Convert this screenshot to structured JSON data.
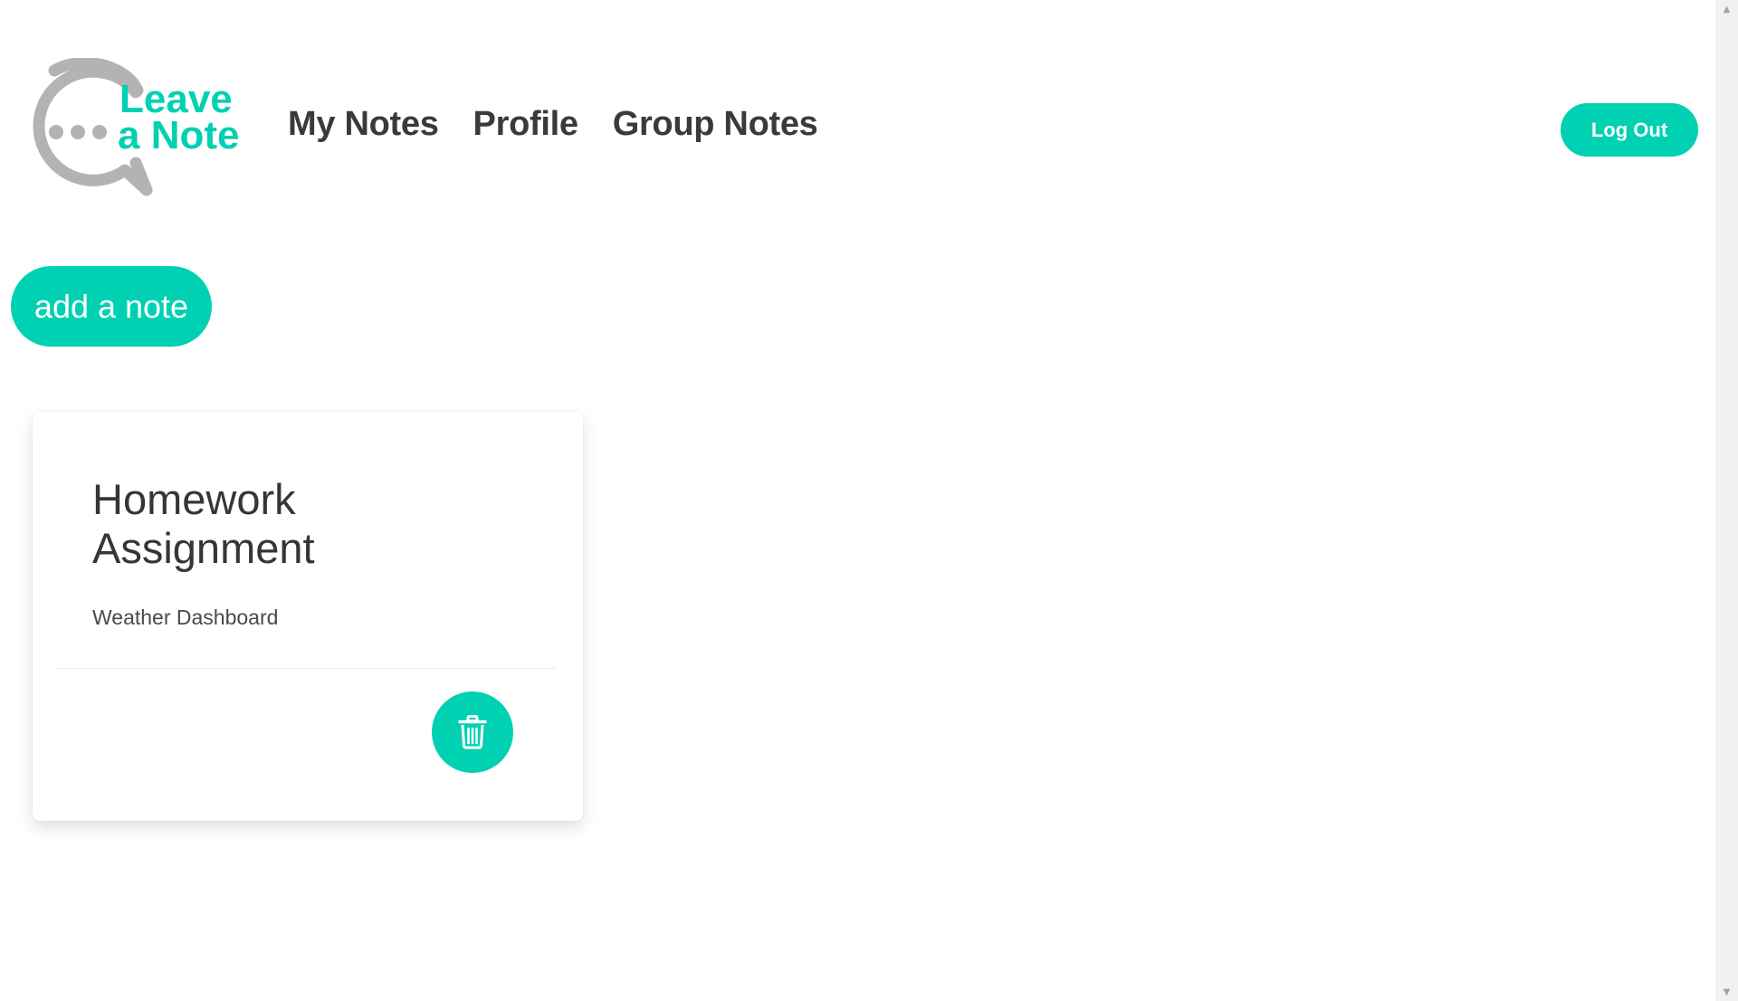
{
  "brand": {
    "logo_line1": "Leave",
    "logo_line2": "a Note",
    "accent_color": "#00d1b2",
    "logo_bubble_color": "#b3b3b3"
  },
  "nav": {
    "items": [
      {
        "label": "My Notes"
      },
      {
        "label": "Profile"
      },
      {
        "label": "Group Notes"
      }
    ],
    "logout_label": "Log Out"
  },
  "actions": {
    "add_note_label": "add a note"
  },
  "notes": [
    {
      "title": "Homework Assignment",
      "description": "Weather Dashboard",
      "delete_icon": "trash-icon"
    }
  ]
}
